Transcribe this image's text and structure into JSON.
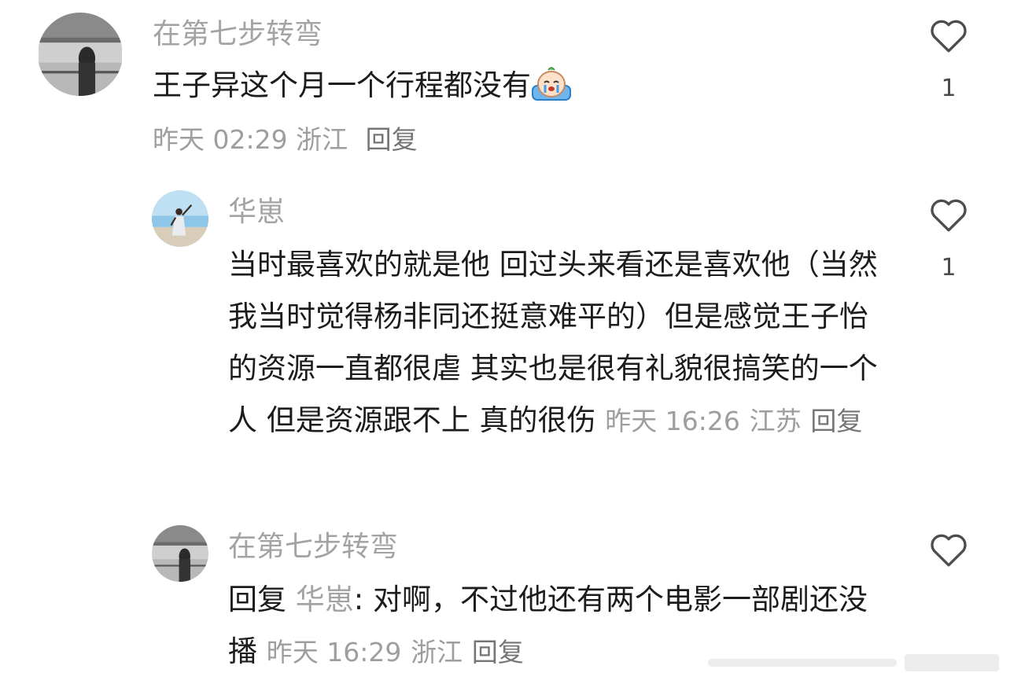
{
  "comments": [
    {
      "author": "在第七步转弯",
      "text": "王子异这个月一个行程都没有",
      "emoji": "crying-bun-emoji",
      "date": "昨天 02:29",
      "location": "浙江",
      "reply_label": "回复",
      "likes": "1"
    },
    {
      "author": "华崽",
      "text": "当时最喜欢的就是他 回过头来看还是喜欢他（当然我当时觉得杨非同还挺意难平的）但是感觉王子怡的资源一直都很虐 其实也是很有礼貌很搞笑的一个人 但是资源跟不上 真的很伤",
      "date": "昨天 16:26",
      "location": "江苏",
      "reply_label": "回复",
      "likes": "1"
    },
    {
      "author": "在第七步转弯",
      "reply_prefix": "回复",
      "reply_to": "华崽",
      "text": ": 对啊，不过他还有两个电影一部剧还没播",
      "date": "昨天 16:29",
      "location": "浙江",
      "reply_label": "回复"
    }
  ],
  "icons": {
    "like": "heart-outline-icon"
  },
  "colors": {
    "name": "#a3a3a3",
    "meta": "#9e9e9e",
    "text": "#1c1c1c"
  }
}
